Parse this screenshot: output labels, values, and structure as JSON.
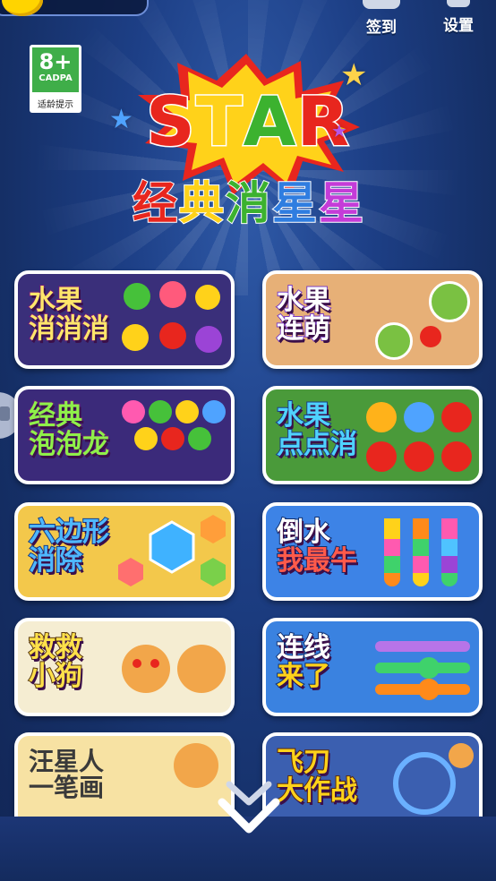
{
  "top": {
    "coin_value": "",
    "signin_label": "签到",
    "settings_label": "设置"
  },
  "age_rating": {
    "rating": "8+",
    "org": "CADPA",
    "tip": "适龄提示"
  },
  "logo": {
    "star_letters": [
      "S",
      "T",
      "A",
      "R"
    ],
    "subtitle_chars": [
      "经",
      "典",
      "消",
      "星",
      "星"
    ]
  },
  "games": [
    {
      "title_lines": [
        "水果",
        "消消消"
      ]
    },
    {
      "title_lines": [
        "水果",
        "连萌"
      ]
    },
    {
      "title_lines": [
        "经典",
        "泡泡龙"
      ]
    },
    {
      "title_lines": [
        "水果",
        "点点消"
      ]
    },
    {
      "title_lines": [
        "六边形",
        "消除"
      ]
    },
    {
      "title_lines": [
        "倒水",
        "我最牛"
      ]
    },
    {
      "title_lines": [
        "救救",
        "小狗"
      ]
    },
    {
      "title_lines": [
        "连线",
        "来了"
      ]
    },
    {
      "title_lines": [
        "汪星人",
        "一笔画"
      ]
    },
    {
      "title_lines": [
        "飞刀",
        "大作战"
      ]
    }
  ],
  "colors": {
    "bg_dark": "#122656",
    "bg_light": "#2f5aa8",
    "star_red": "#e8261e",
    "star_yellow": "#ffd21a",
    "star_green": "#3cb22f",
    "star_blue": "#2f7de0"
  },
  "icons": {
    "scroll_down": "double-chevron-down",
    "side_tab": "gamepad"
  }
}
